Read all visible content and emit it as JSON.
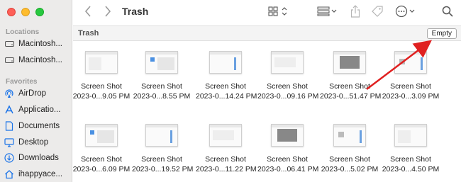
{
  "window": {
    "title": "Trash"
  },
  "toolbar": {
    "back_icon": "chevron-left-icon",
    "forward_icon": "chevron-right-icon",
    "view_icon": "icon-grid-view-icon",
    "group_icon": "group-list-icon",
    "share_icon": "share-icon",
    "tag_icon": "tag-icon",
    "more_icon": "ellipsis-circle-icon",
    "search_icon": "search-icon"
  },
  "sidebar": {
    "locations_title": "Locations",
    "favorites_title": "Favorites",
    "locations": [
      {
        "label": "Macintosh...",
        "icon": "hard-drive-icon"
      },
      {
        "label": "Macintosh...",
        "icon": "hard-drive-icon"
      }
    ],
    "favorites": [
      {
        "label": "AirDrop",
        "icon": "airdrop-icon"
      },
      {
        "label": "Applicatio...",
        "icon": "applications-icon"
      },
      {
        "label": "Documents",
        "icon": "document-icon"
      },
      {
        "label": "Desktop",
        "icon": "desktop-icon"
      },
      {
        "label": "Downloads",
        "icon": "downloads-icon"
      },
      {
        "label": "ihappyace...",
        "icon": "home-icon"
      }
    ]
  },
  "pathbar": {
    "label": "Trash",
    "empty_button": "Empty"
  },
  "files": [
    {
      "name": "Screen Shot",
      "date": "2023-0...9.05 PM"
    },
    {
      "name": "Screen Shot",
      "date": "2023-0...8.55 PM"
    },
    {
      "name": "Screen Shot",
      "date": "2023-0...14.24 PM"
    },
    {
      "name": "Screen Shot",
      "date": "2023-0...09.16 PM"
    },
    {
      "name": "Screen Shot",
      "date": "2023-0...51.47 PM"
    },
    {
      "name": "Screen Shot",
      "date": "2023-0...3.09 PM"
    },
    {
      "name": "Screen Shot",
      "date": "2023-0...6.09 PM"
    },
    {
      "name": "Screen Shot",
      "date": "2023-0...19.52 PM"
    },
    {
      "name": "Screen Shot",
      "date": "2023-0...11.22 PM"
    },
    {
      "name": "Screen Shot",
      "date": "2023-0...06.41 PM"
    },
    {
      "name": "Screen Shot",
      "date": "2023-0...5.02 PM"
    },
    {
      "name": "Screen Shot",
      "date": "2023-0...4.50 PM"
    }
  ],
  "colors": {
    "annotation_arrow": "#e02020",
    "accent": "#1a73e8"
  }
}
